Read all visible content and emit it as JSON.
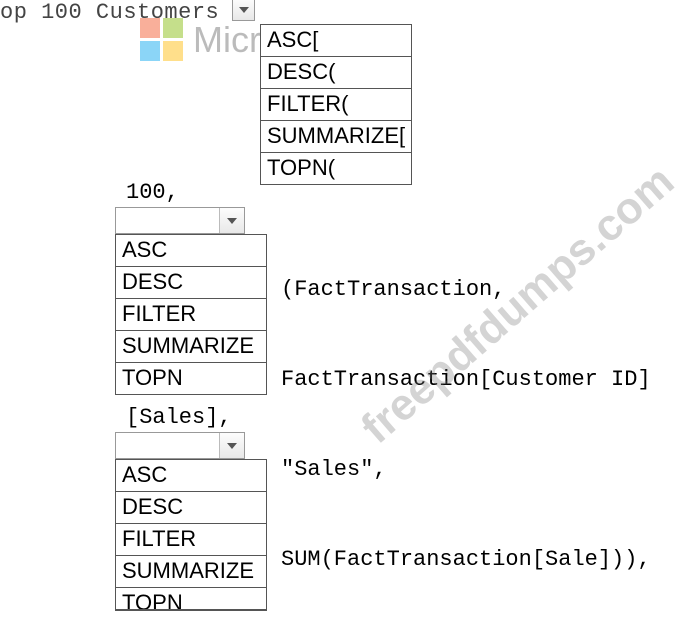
{
  "top_label": "op 100 Customers =",
  "listbox1": {
    "items": [
      "ASC[",
      "DESC(",
      "FILTER(",
      "SUMMARIZE[",
      "TOPN("
    ]
  },
  "line_100": "100,",
  "listbox2": {
    "items": [
      "ASC",
      "DESC",
      "FILTER",
      "SUMMARIZE",
      "TOPN"
    ]
  },
  "code_block1": {
    "l1": "(FactTransaction,",
    "l2": "FactTransaction[Customer ID]",
    "l3": "\"Sales\",",
    "l4": "SUM(FactTransaction[Sale])),"
  },
  "sales_line": "[Sales],",
  "listbox3": {
    "items": [
      "ASC",
      "DESC",
      "FILTER",
      "SUMMARIZE",
      "TOPN"
    ]
  },
  "watermarks": {
    "ms": "Microsoft",
    "site": "freepdfdumps.com"
  }
}
